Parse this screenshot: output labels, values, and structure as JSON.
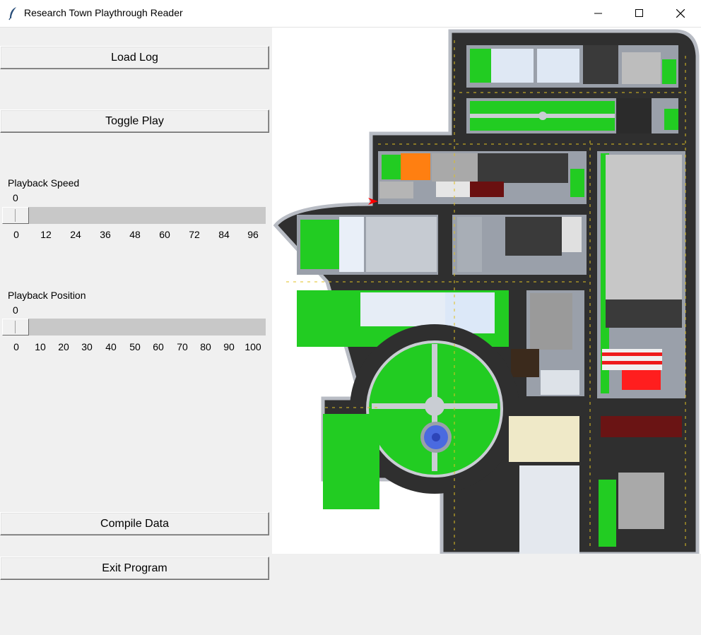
{
  "window": {
    "title": "Research Town Playthrough Reader"
  },
  "buttons": {
    "load_log": "Load Log",
    "toggle_play": "Toggle Play",
    "compile_data": "Compile Data",
    "exit_program": "Exit Program"
  },
  "speed": {
    "label": "Playback Speed",
    "value": "0",
    "ticks": [
      "0",
      "12",
      "24",
      "36",
      "48",
      "60",
      "72",
      "84",
      "96"
    ]
  },
  "position": {
    "label": "Playback Position",
    "value": "0",
    "ticks": [
      "0",
      "10",
      "20",
      "30",
      "40",
      "50",
      "60",
      "70",
      "80",
      "90",
      "100"
    ]
  },
  "colors": {
    "grass": "#22cc22",
    "road": "#333333",
    "path_marker": "#ff0000",
    "fountain": "#4a6ae0"
  }
}
